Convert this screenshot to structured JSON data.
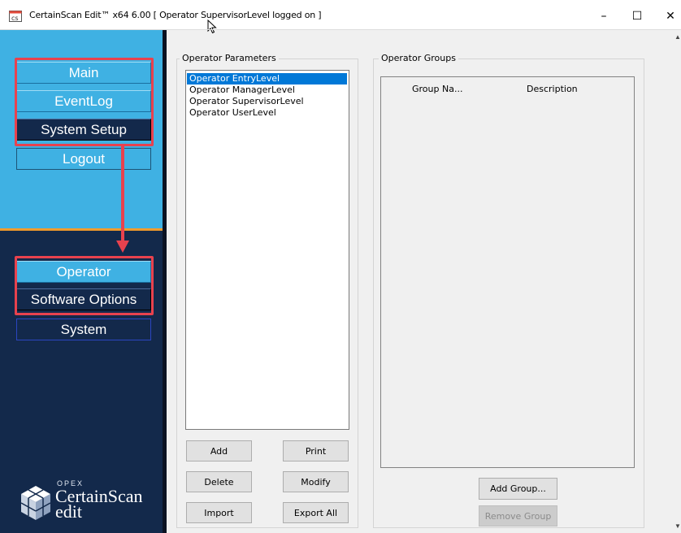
{
  "window": {
    "title": "CertainScan Edit™ x64 6.00  [ Operator SupervisorLevel logged on ]",
    "minimize": "–",
    "maximize": "☐",
    "close": "✕"
  },
  "sidebar": {
    "top_menu": [
      {
        "label": "Main",
        "highlighted": true
      },
      {
        "label": "EventLog",
        "highlighted": true
      },
      {
        "label": "System Setup",
        "highlighted": true,
        "selected": true
      },
      {
        "label": "Logout",
        "highlighted": false
      }
    ],
    "sub_menu": [
      {
        "label": "Operator",
        "highlighted": true,
        "selected": true
      },
      {
        "label": "Software Options",
        "highlighted": true
      },
      {
        "label": "System",
        "highlighted": false
      }
    ],
    "logo": {
      "brand": "OPEX",
      "name": "CertainScan",
      "sub": "edit"
    }
  },
  "operator_parameters": {
    "title": "Operator Parameters",
    "items": [
      "Operator EntryLevel",
      "Operator ManagerLevel",
      "Operator SupervisorLevel",
      "Operator UserLevel"
    ],
    "selected_index": 0,
    "buttons": {
      "add": "Add",
      "print": "Print",
      "delete": "Delete",
      "modify": "Modify",
      "import": "Import",
      "export_all": "Export All"
    }
  },
  "operator_groups": {
    "title": "Operator Groups",
    "columns": [
      "Group Na...",
      "Description"
    ],
    "buttons": {
      "add_group": "Add Group...",
      "remove_group": "Remove Group"
    }
  },
  "colors": {
    "sidebar_light": "#3fb1e3",
    "sidebar_dark": "#13294b",
    "accent_orange": "#f39b2a",
    "annotation_red": "#e8424e",
    "selection_blue": "#0078d7"
  }
}
